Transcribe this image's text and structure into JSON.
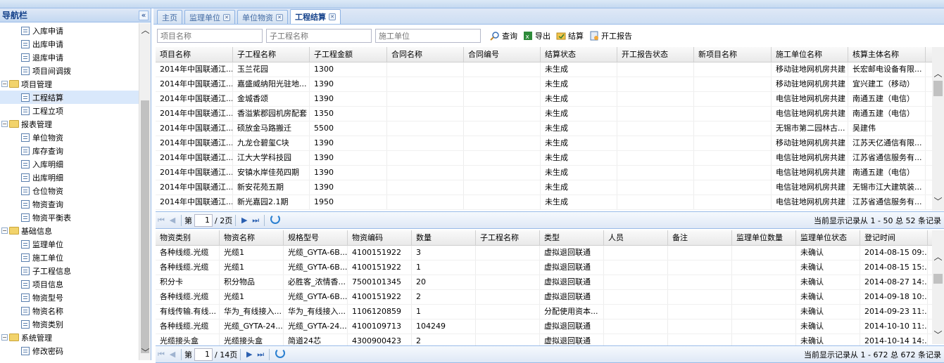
{
  "sidebar": {
    "title": "导航栏",
    "collapse_icon": "«",
    "items": [
      {
        "label": "入库申请",
        "type": "leaf"
      },
      {
        "label": "出库申请",
        "type": "leaf"
      },
      {
        "label": "退库申请",
        "type": "leaf"
      },
      {
        "label": "项目间调拨",
        "type": "leaf"
      },
      {
        "label": "项目管理",
        "type": "folder"
      },
      {
        "label": "工程结算",
        "type": "leaf",
        "selected": true
      },
      {
        "label": "工程立项",
        "type": "leaf"
      },
      {
        "label": "报表管理",
        "type": "folder"
      },
      {
        "label": "单位物资",
        "type": "leaf"
      },
      {
        "label": "库存查询",
        "type": "leaf"
      },
      {
        "label": "入库明细",
        "type": "leaf"
      },
      {
        "label": "出库明细",
        "type": "leaf"
      },
      {
        "label": "仓位物资",
        "type": "leaf"
      },
      {
        "label": "物资查询",
        "type": "leaf"
      },
      {
        "label": "物资平衡表",
        "type": "leaf"
      },
      {
        "label": "基础信息",
        "type": "folder"
      },
      {
        "label": "监理单位",
        "type": "leaf"
      },
      {
        "label": "施工单位",
        "type": "leaf"
      },
      {
        "label": "子工程信息",
        "type": "leaf"
      },
      {
        "label": "项目信息",
        "type": "leaf"
      },
      {
        "label": "物资型号",
        "type": "leaf"
      },
      {
        "label": "物资名称",
        "type": "leaf"
      },
      {
        "label": "物资类别",
        "type": "leaf"
      },
      {
        "label": "系统管理",
        "type": "folder"
      },
      {
        "label": "修改密码",
        "type": "leaf"
      }
    ]
  },
  "tabs": [
    {
      "label": "主页",
      "closable": false,
      "active": false
    },
    {
      "label": "监理单位",
      "closable": true,
      "active": false
    },
    {
      "label": "单位物资",
      "closable": true,
      "active": false
    },
    {
      "label": "工程结算",
      "closable": true,
      "active": true
    }
  ],
  "toolbar": {
    "project_placeholder": "项目名称",
    "subproject_placeholder": "子工程名称",
    "contractor_placeholder": "施工单位",
    "query_label": "查询",
    "export_label": "导出",
    "settle_label": "结算",
    "report_label": "开工报告"
  },
  "grid1": {
    "columns": [
      "项目名称",
      "子工程名称",
      "子工程金额",
      "合同名称",
      "合同编号",
      "结算状态",
      "开工报告状态",
      "新项目名称",
      "施工单位名称",
      "核算主体名称"
    ],
    "rows": [
      [
        "2014年中国联通江...",
        "玉兰花园",
        "1300",
        "",
        "",
        "未生成",
        "",
        "",
        "移动驻地网机房共建",
        "长宏邮电设备有限..."
      ],
      [
        "2014年中国联通江...",
        "嘉盛威纳阳光驻地...",
        "1390",
        "",
        "",
        "未生成",
        "",
        "",
        "移动驻地网机房共建",
        "宜兴建工（移动）"
      ],
      [
        "2014年中国联通江...",
        "金城香颂",
        "1390",
        "",
        "",
        "未生成",
        "",
        "",
        "电信驻地网机房共建",
        "南通五建（电信）"
      ],
      [
        "2014年中国联通江...",
        "香溢紫郡园机房配套",
        "1350",
        "",
        "",
        "未生成",
        "",
        "",
        "电信驻地网机房共建",
        "南通五建（电信）"
      ],
      [
        "2014年中国联通江...",
        "硕放金马路搬迁",
        "5500",
        "",
        "",
        "未生成",
        "",
        "",
        "无锡市第二园林古...",
        "吴建伟"
      ],
      [
        "2014年中国联通江...",
        "九龙仓碧玺C块",
        "1390",
        "",
        "",
        "未生成",
        "",
        "",
        "移动驻地网机房共建",
        "江苏天亿通信有限..."
      ],
      [
        "2014年中国联通江...",
        "江大大学科技园",
        "1390",
        "",
        "",
        "未生成",
        "",
        "",
        "电信驻地网机房共建",
        "江苏省通信服务有..."
      ],
      [
        "2014年中国联通江...",
        "安镇水岸佳苑四期",
        "1390",
        "",
        "",
        "未生成",
        "",
        "",
        "电信驻地网机房共建",
        "南通五建（电信）"
      ],
      [
        "2014年中国联通江...",
        "新安花苑五期",
        "1390",
        "",
        "",
        "未生成",
        "",
        "",
        "电信驻地网机房共建",
        "无锡市江大建筑装..."
      ],
      [
        "2014年中国联通江...",
        "新光嘉园2.1期",
        "1950",
        "",
        "",
        "未生成",
        "",
        "",
        "电信驻地网机房共建",
        "江苏省通信服务有..."
      ]
    ]
  },
  "pager1": {
    "page_prefix": "第",
    "page": "1",
    "page_suffix": "/ 2页",
    "info": "当前显示记录从 1 - 50 总 52 条记录"
  },
  "grid2": {
    "columns": [
      "物资类别",
      "物资名称",
      "规格型号",
      "物资编码",
      "数量",
      "子工程名称",
      "类型",
      "人员",
      "备注",
      "监理单位数量",
      "监理单位状态",
      "登记时间"
    ],
    "rows": [
      [
        "各种线缆.光缆",
        "光缆1",
        "光缆_GYTA-6B...",
        "4100151922",
        "3",
        "",
        "虚拟退回联通",
        "",
        "",
        "",
        "未确认",
        "2014-08-15 09:..."
      ],
      [
        "各种线缆.光缆",
        "光缆1",
        "光缆_GYTA-6B...",
        "4100151922",
        "1",
        "",
        "虚拟退回联通",
        "",
        "",
        "",
        "未确认",
        "2014-08-15 15:..."
      ],
      [
        "积分卡",
        "积分物品",
        "必胜客_浓情香...",
        "7500101345",
        "20",
        "",
        "虚拟退回联通",
        "",
        "",
        "",
        "未确认",
        "2014-08-27 14:..."
      ],
      [
        "各种线缆.光缆",
        "光缆1",
        "光缆_GYTA-6B...",
        "4100151922",
        "2",
        "",
        "虚拟退回联通",
        "",
        "",
        "",
        "未确认",
        "2014-09-18 10:..."
      ],
      [
        "有线传输.有线...",
        "华为_有线接入...",
        "华为_有线接入...",
        "1106120859",
        "1",
        "",
        "分配使用资本...",
        "",
        "",
        "",
        "未确认",
        "2014-09-23 11:..."
      ],
      [
        "各种线缆.光缆",
        "光缆_GYTA-24...",
        "光缆_GYTA-24...",
        "4100109713",
        "104249",
        "",
        "虚拟退回联通",
        "",
        "",
        "",
        "未确认",
        "2014-10-10 11:..."
      ],
      [
        "光缆接头盒",
        "光缆接头盒",
        "简道24芯",
        "4300900423",
        "2",
        "",
        "虚拟退回联通",
        "",
        "",
        "",
        "未确认",
        "2014-10-14 14:..."
      ]
    ]
  },
  "pager2": {
    "page_prefix": "第",
    "page": "1",
    "page_suffix": "/ 14页",
    "info": "当前显示记录从 1 - 672 总 672 条记录"
  }
}
